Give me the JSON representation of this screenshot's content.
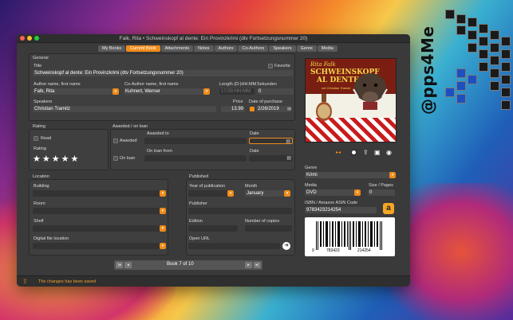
{
  "window_title": "Falk, Rita • Schweinskopf al dente: Ein Provinzkrimi (dtv Fortsetzungsnummer 20)",
  "tabs": [
    "My Books",
    "Current Book",
    "Attachments",
    "Notes",
    "Authors",
    "Co-Authors",
    "Speakers",
    "Genre",
    "Media"
  ],
  "general": {
    "header": "General",
    "title_label": "Title",
    "favorite_label": "Favorite",
    "title_value": "Schweinskopf al dente: Ein Provinzkrimi (dtv Fortsetzungsnummer 20)",
    "author_label": "Author name, first name",
    "author_value": "Falk, Rita",
    "coauthor_label": "Co-Author name, first name",
    "coauthor_value": "Kuhnert, Werner",
    "length_label": "Length (D:)HH:MM",
    "seconds_label": "Sekunden",
    "length_placeholder": "17:00:HH:MM",
    "seconds_value": "0",
    "speakers_label": "Speakers",
    "speakers_value": "Christian Tramitz",
    "price_label": "Price",
    "price_value": "13.99",
    "purchase_label": "Date of purchase",
    "purchase_value": "2/26/2019"
  },
  "rating": {
    "header": "Rating",
    "read_label": "Read",
    "rating_label": "Rating",
    "stars": "★★★★★"
  },
  "loan": {
    "header": "Awarded / on loan",
    "awarded_to_label": "Awarded to",
    "awarded_label": "Awarded",
    "date_label": "Date",
    "loan_from_label": "On loan from",
    "on_loan_label": "On loan",
    "date2_label": "Date"
  },
  "location": {
    "header": "Location",
    "building_label": "Building",
    "room_label": "Room",
    "shelf_label": "Shelf",
    "digital_label": "Digital file location"
  },
  "published": {
    "header": "Published",
    "year_label": "Year of publication",
    "month_label": "Month",
    "month_value": "January",
    "publisher_label": "Publisher",
    "edition_label": "Edition",
    "copies_label": "Number of copies",
    "url_label": "Open URL"
  },
  "genre": {
    "label": "Genre",
    "value": "Krimi"
  },
  "media": {
    "label": "Media",
    "value": "DVD",
    "pages_label": "Size / Pages",
    "pages_value": "0"
  },
  "isbn": {
    "label": "ISBN / Amazon ASIN Code",
    "value": "9783423214254"
  },
  "barcode": {
    "left": "9",
    "mid1": "783423",
    "mid2": "214254"
  },
  "cover": {
    "author": "Rita Falk",
    "title1": "SCHWEINSKOPF",
    "title2": "AL DENTE",
    "subtitle": "mit Christian Tramitz"
  },
  "nav": {
    "label": "Book  7 of 10"
  },
  "status": {
    "text": "The changes has been saved"
  },
  "watermark": {
    "text": "@pps4Me"
  }
}
